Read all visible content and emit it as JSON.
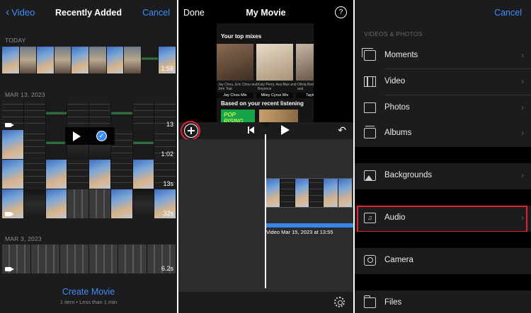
{
  "recent": {
    "back_label": "Video",
    "title": "Recently Added",
    "cancel_label": "Cancel",
    "sections": [
      {
        "label": "TODAY",
        "strips": [
          {
            "duration": "1:58"
          }
        ]
      },
      {
        "label": "MAR 13, 2023",
        "strips": [
          {
            "duration": "13"
          },
          {
            "duration": "1:02"
          },
          {
            "duration": "13s"
          },
          {
            "duration": "32s"
          }
        ]
      },
      {
        "label": "MAR 3, 2023",
        "strips": [
          {
            "duration": "6.2s"
          }
        ]
      }
    ],
    "create_label": "Create Movie",
    "create_sub": "1 item • Less than 1 min",
    "check_glyph": "✓"
  },
  "editor": {
    "done_label": "Done",
    "title": "My Movie",
    "help_glyph": "?",
    "undo_glyph": "↶",
    "preview": {
      "heading1": "Your top mixes",
      "mixes": [
        {
          "label": "Jay Chou Mix",
          "sub": "Jay Chou, Eric Chou and JoIn Tsai"
        },
        {
          "label": "Miley Cyrus Mix",
          "sub": "Katy Perry, Ava Max and Beyonce"
        },
        {
          "label": "Taylor Sw",
          "sub": "Olivia Rodrigo, Direction and"
        }
      ],
      "heading2": "Based on your recent listening",
      "pop_label": "POP RISING"
    },
    "clip_label": "Video Mar 15, 2023 at 13:55"
  },
  "media": {
    "cancel_label": "Cancel",
    "section": "VIDEOS & PHOTOS",
    "rows": [
      {
        "label": "Moments",
        "icon": "moments-icon"
      },
      {
        "label": "Video",
        "icon": "video-icon"
      },
      {
        "label": "Photos",
        "icon": "photos-icon"
      },
      {
        "label": "Albums",
        "icon": "albums-icon"
      },
      {
        "label": "Backgrounds",
        "icon": "backgrounds-icon"
      },
      {
        "label": "Audio",
        "icon": "audio-icon"
      },
      {
        "label": "Camera",
        "icon": "camera-icon"
      },
      {
        "label": "Files",
        "icon": "files-icon"
      }
    ],
    "chevron": "›"
  },
  "colors": {
    "accent": "#3d8ef7",
    "highlight": "#e0242b",
    "selection": "#f2c14e"
  }
}
